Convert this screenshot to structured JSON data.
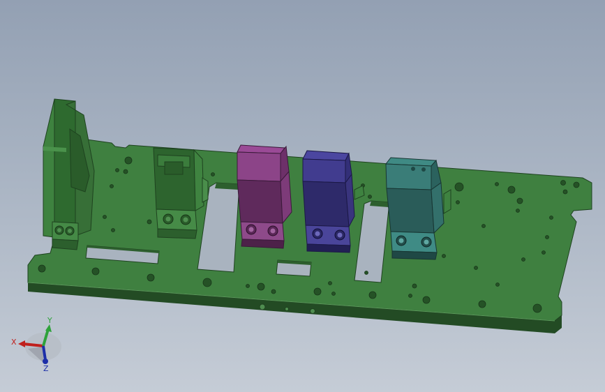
{
  "viewport": {
    "background_top": "#93a0b3",
    "background_bottom": "#c5ccd6"
  },
  "part_colors": {
    "plate": "#3d7f3d",
    "plate_dark": "#2f6530",
    "plate_edge": "#244f26",
    "bracket_green": "#3a7a3a",
    "block_magenta": "#7a3a78",
    "block_indigo": "#3a3577",
    "block_teal": "#2f6a66"
  },
  "triad": {
    "x_label": "X",
    "y_label": "Y",
    "z_label": "Z",
    "x_color": "#c0201d",
    "y_color": "#2ea23a",
    "z_color": "#1c2ea8"
  }
}
